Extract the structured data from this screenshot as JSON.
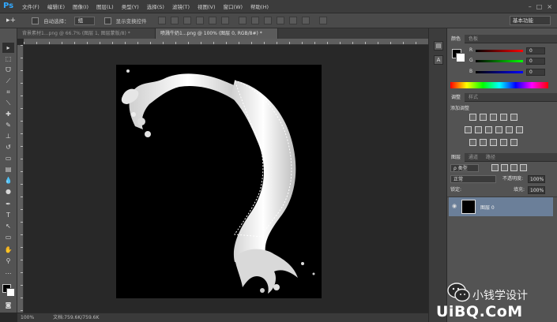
{
  "app": {
    "logo": "Ps"
  },
  "menu": [
    "文件(F)",
    "编辑(E)",
    "图像(I)",
    "图层(L)",
    "类型(Y)",
    "选择(S)",
    "滤镜(T)",
    "视图(V)",
    "窗口(W)",
    "帮助(H)"
  ],
  "window_controls": [
    "–",
    "□",
    "×"
  ],
  "options_bar": {
    "auto_select_label": "自动选择：",
    "auto_select_value": "组",
    "show_transform_label": "显示变换控件",
    "workspace": "基本功能"
  },
  "tabs": [
    {
      "label": "背景素材1...png @ 66.7% (图层 1, 图层蒙版/8) *",
      "active": false
    },
    {
      "label": "喷溅牛奶1...png @ 100% (图层 0, RGB/8#) *",
      "active": true
    }
  ],
  "status": {
    "zoom": "100%",
    "doc": "文档:759.6K/759.6K"
  },
  "panels": {
    "color_tabs": [
      "颜色",
      "色板"
    ],
    "color": {
      "r_label": "R",
      "g_label": "G",
      "b_label": "B",
      "r": "0",
      "g": "0",
      "b": "0"
    },
    "adjust_tabs": [
      "调整",
      "样式"
    ],
    "adjust_title": "添加调整",
    "layer_tabs": [
      "图层",
      "通道",
      "路径"
    ],
    "kind_label": "ρ 类型",
    "blend_mode": "正常",
    "opacity_label": "不透明度:",
    "opacity": "100%",
    "lock_label": "锁定:",
    "fill_label": "填充:",
    "fill": "100%",
    "layer_name": "图层 0"
  },
  "watermark": {
    "text": "小钱学设计",
    "site": "UiBQ.CoM"
  }
}
